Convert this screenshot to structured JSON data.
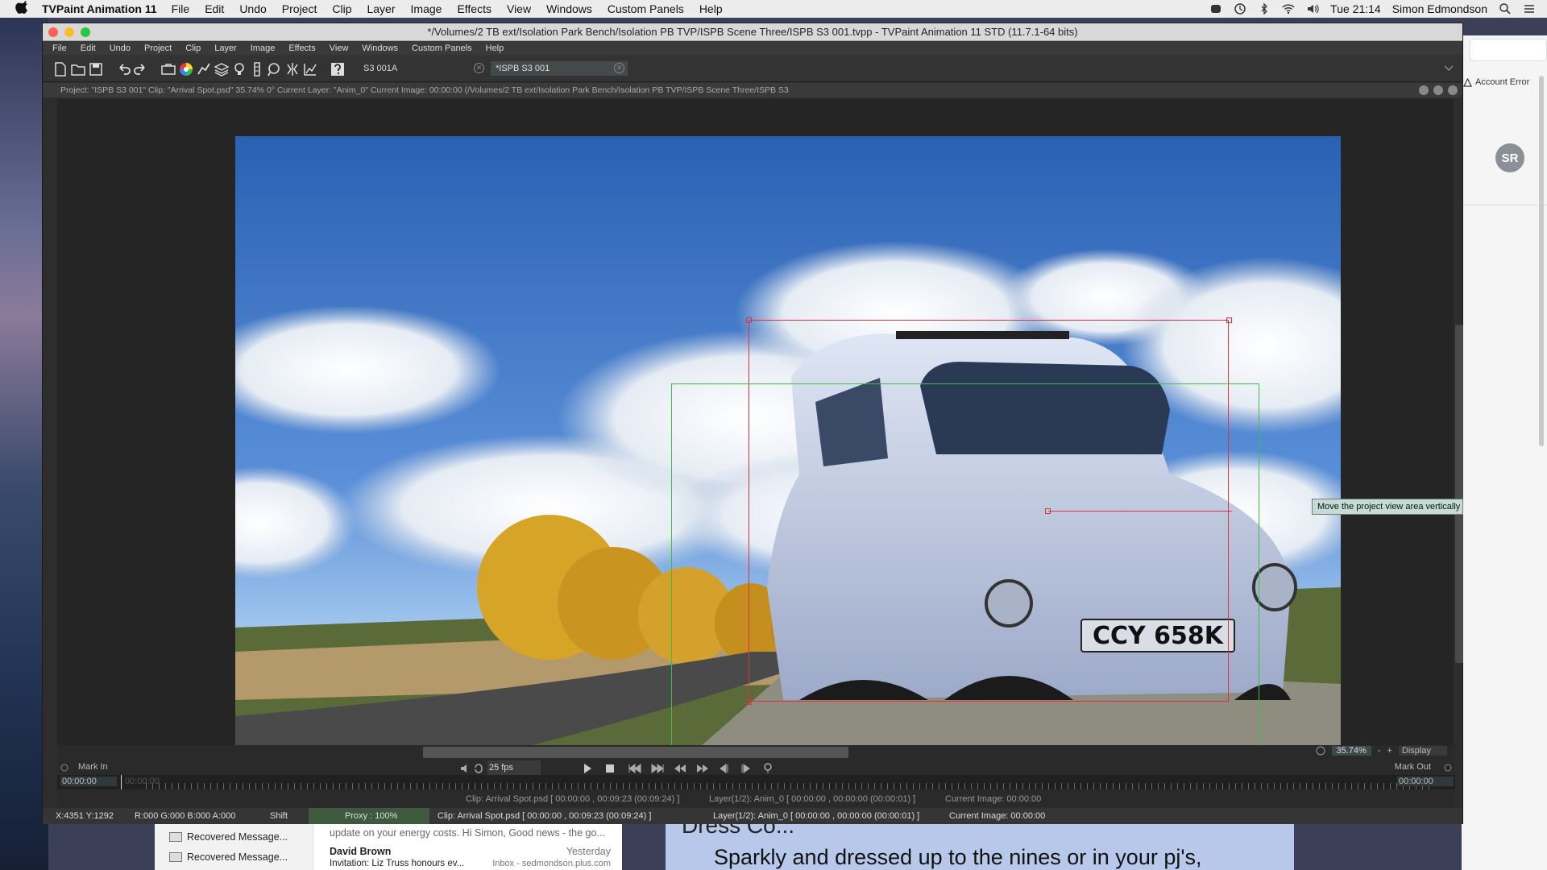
{
  "mac_menubar": {
    "app_name": "TVPaint Animation 11",
    "items": [
      "File",
      "Edit",
      "Undo",
      "Project",
      "Clip",
      "Layer",
      "Image",
      "Effects",
      "View",
      "Windows",
      "Custom Panels",
      "Help"
    ],
    "clock": "Tue 21:14",
    "user": "Simon Edmondson"
  },
  "window": {
    "title": "*/Volumes/2 TB ext/Isolation Park Bench/Isolation PB TVP/ISPB Scene Three/ISPB S3 001.tvpp - TVPaint Animation 11 STD (11.7.1-64 bits)",
    "menu": [
      "File",
      "Edit",
      "Undo",
      "Project",
      "Clip",
      "Layer",
      "Image",
      "Effects",
      "View",
      "Windows",
      "Custom Panels",
      "Help"
    ],
    "tabs": [
      {
        "label": "S3 001A"
      },
      {
        "label": "*ISPB S3 001"
      }
    ],
    "info_line": "Project: \"ISPB S3 001\"  Clip: \"Arrival Spot.psd\"  35.74%   0°  Current Layer: \"Anim_0\"  Current Image: 00:00:00 (/Volumes/2 TB ext/Isolation Park Bench/Isolation PB TVP/ISPB Scene Three/ISPB S3",
    "tooltip": "Move the project view area vertically"
  },
  "photo": {
    "plate": "CCY 658K"
  },
  "timeline": {
    "mark_in": "Mark In",
    "mark_out": "Mark Out",
    "fps": "25 fps",
    "zoom": "35.74%",
    "display": "Display",
    "time_start": "00:00:00",
    "time_ghost": "00:00:00",
    "time_end": "00:00:00",
    "clip_info": "Clip: Arrival Spot.psd [ 00:00:00 , 00:09:23  (00:09:24) ]",
    "layer_info": "Layer(1/2): Anim_0 [ 00:00:00 , 00:00:00  (00:00:01) ]",
    "current_image": "Current Image: 00:00:00"
  },
  "statusbar": {
    "coords": "X:4351  Y:1292",
    "color": "R:000 G:000 B:000 A:000",
    "modifier": "Shift",
    "proxy": "Proxy : 100%"
  },
  "right_app": {
    "account_error": "Account Error",
    "avatar": "SR"
  },
  "mail": {
    "folders": [
      "Recovered Message...",
      "Recovered Message..."
    ],
    "preview": "update on your energy costs. Hi Simon, Good news - the go...",
    "sender": "David Brown",
    "date": "Yesterday",
    "subject": "Invitation: Liz Truss honours ev...",
    "inbox": "Inbox - sedmondson.plus.com",
    "newsletter_head": "Dress Co...",
    "newsletter_body": "Sparkly and dressed up to the nines or in your pj's,"
  },
  "colors": {
    "selection_red": "#e0323c",
    "selection_green": "#3fbf3f",
    "tooltip_bg": "#c4dbd6"
  }
}
